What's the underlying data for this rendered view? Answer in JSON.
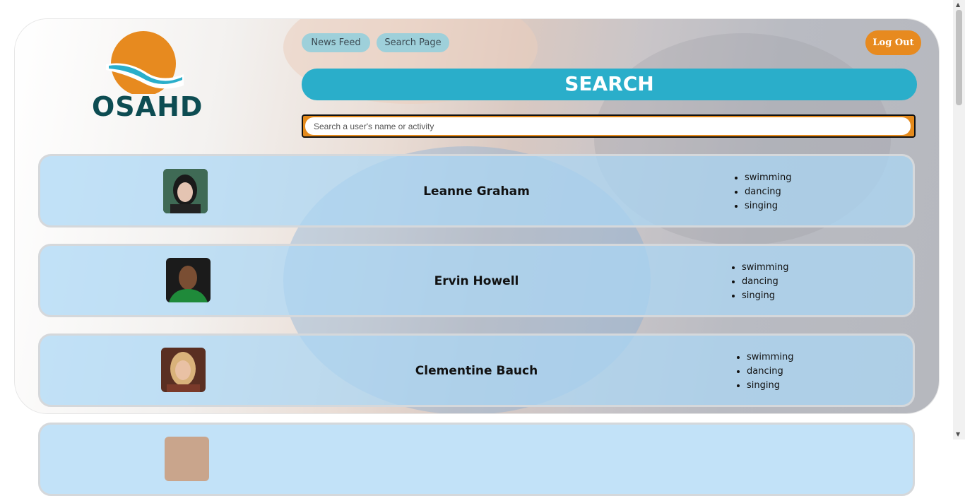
{
  "logo": {
    "text": "OSAHD"
  },
  "nav": {
    "news_feed": "News Feed",
    "search_page": "Search Page",
    "log_out": "Log Out"
  },
  "search": {
    "title": "SEARCH",
    "placeholder": "Search a user's name or activity"
  },
  "users": [
    {
      "name": "Leanne Graham",
      "activities": [
        "swimming",
        "dancing",
        "singing"
      ]
    },
    {
      "name": "Ervin Howell",
      "activities": [
        "swimming",
        "dancing",
        "singing"
      ]
    },
    {
      "name": "Clementine Bauch",
      "activities": [
        "swimming",
        "dancing",
        "singing"
      ]
    }
  ],
  "colors": {
    "accent_orange": "#e78a1f",
    "banner_teal": "#2aaeca",
    "nav_pill": "#9ed0da",
    "logo_dark": "#0d4c52"
  }
}
